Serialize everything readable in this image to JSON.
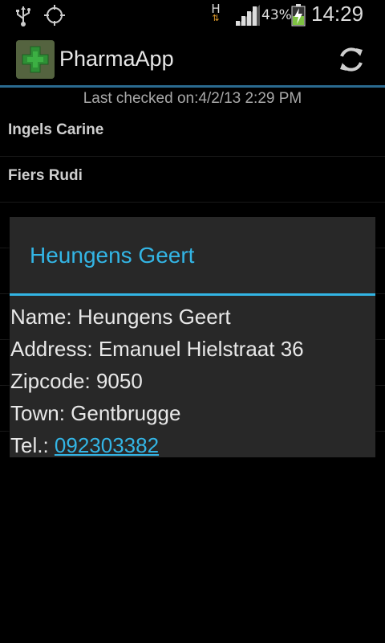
{
  "status_bar": {
    "network_type": "H",
    "battery_percent": "43%",
    "time": "14:29",
    "icons": [
      "usb-icon",
      "gps-icon",
      "network-activity-icon",
      "signal-icon",
      "battery-charging-icon"
    ]
  },
  "action_bar": {
    "title": "PharmaApp",
    "icons": [
      "app-icon",
      "refresh-icon"
    ]
  },
  "content": {
    "last_checked": "Last checked on:4/2/13 2:29 PM",
    "items": [
      {
        "label": "Ingels Carine"
      },
      {
        "label": "Fiers Rudi"
      }
    ]
  },
  "dialog": {
    "title": "Heungens Geert",
    "name_label": "Name: ",
    "name": "Heungens Geert",
    "address_label": "Address: ",
    "address": "Emanuel Hielstraat 36",
    "zipcode_label": "Zipcode: ",
    "zipcode": "9050",
    "town_label": "Town: ",
    "town": "Gentbrugge",
    "tel_label": "Tel.: ",
    "tel": "092303382"
  },
  "colors": {
    "accent": "#33b5e5",
    "actionbar_divider": "#2a6a90",
    "dialog_bg": "#282828"
  }
}
